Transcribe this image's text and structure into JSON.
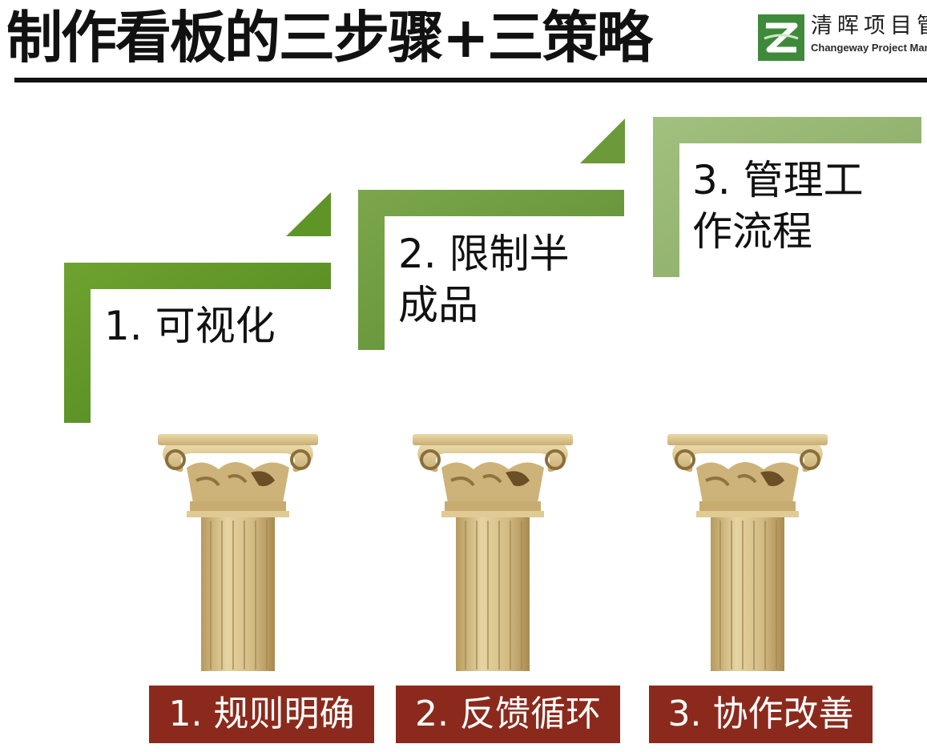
{
  "title": "制作看板的三步骤+三策略",
  "logo": {
    "name_cn": "清晖项目管",
    "name_en": "Changeway Project Man",
    "icon": "changeway-logo-icon"
  },
  "steps": [
    {
      "label_line1": "1. 可视化",
      "label_line2": ""
    },
    {
      "label_line1": "2. 限制半",
      "label_line2": "成品"
    },
    {
      "label_line1": "3. 管理工",
      "label_line2": "作流程"
    }
  ],
  "pillars": [
    {
      "icon": "corinthian-column-icon",
      "label": "1. 规则明确"
    },
    {
      "icon": "corinthian-column-icon",
      "label": "2. 反馈循环"
    },
    {
      "icon": "corinthian-column-icon",
      "label": "3. 协作改善"
    }
  ],
  "colors": {
    "step_1_green": "#5f9427",
    "step_2_green": "#6c9a3a",
    "step_3_green": "#93b46e",
    "label_red": "#8b2a1c",
    "column_stone": "#d9c28c"
  }
}
